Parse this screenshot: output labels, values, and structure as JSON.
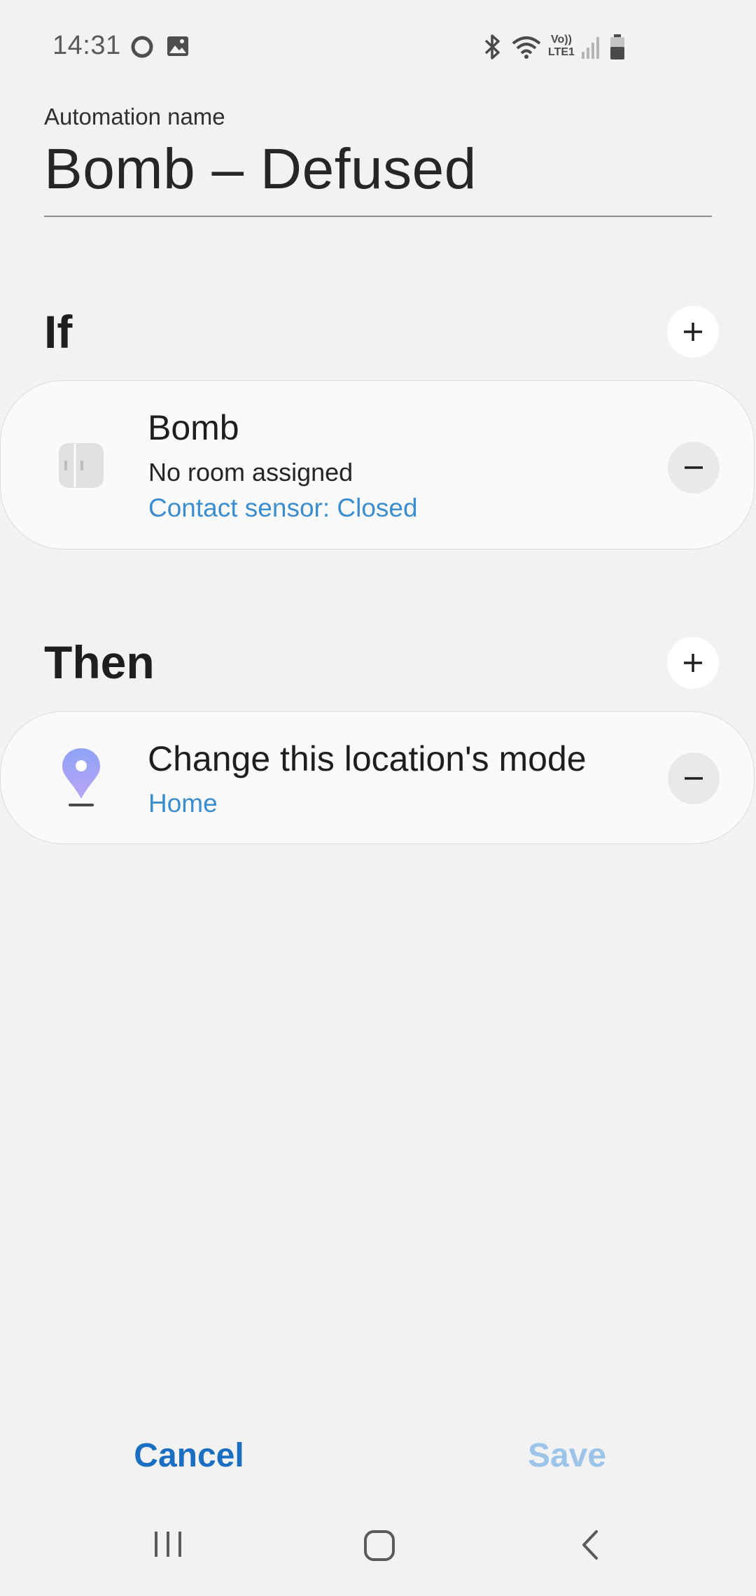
{
  "status_bar": {
    "time": "14:31",
    "left_icons": [
      "sync-ring-icon",
      "gallery-icon"
    ],
    "right_icons": [
      "bluetooth-icon",
      "wifi-icon",
      "volte-lte1-icon",
      "signal-bars-icon",
      "battery-icon"
    ],
    "volte_label": "Vo))",
    "lte_label": "LTE1"
  },
  "automation": {
    "label": "Automation name",
    "name": "Bomb – Defused"
  },
  "if_section": {
    "title": "If",
    "add_icon": "plus-icon",
    "condition": {
      "icon": "contact-sensor-icon",
      "device": "Bomb",
      "room": "No room assigned",
      "status": "Contact sensor: Closed",
      "remove_icon": "minus-icon"
    }
  },
  "then_section": {
    "title": "Then",
    "add_icon": "plus-icon",
    "action": {
      "icon": "location-pin-icon",
      "title": "Change this location's mode",
      "value": "Home",
      "remove_icon": "minus-icon"
    }
  },
  "footer": {
    "cancel_label": "Cancel",
    "save_label": "Save"
  },
  "nav_bar": {
    "icons": [
      "recent-apps-icon",
      "home-icon",
      "back-icon"
    ]
  },
  "colors": {
    "background": "#f2f2f2",
    "link_blue": "#3a8dce",
    "cancel_blue": "#1b6fc2",
    "save_disabled": "#9cc4e8",
    "pin_purple": "#9d9ef7"
  }
}
